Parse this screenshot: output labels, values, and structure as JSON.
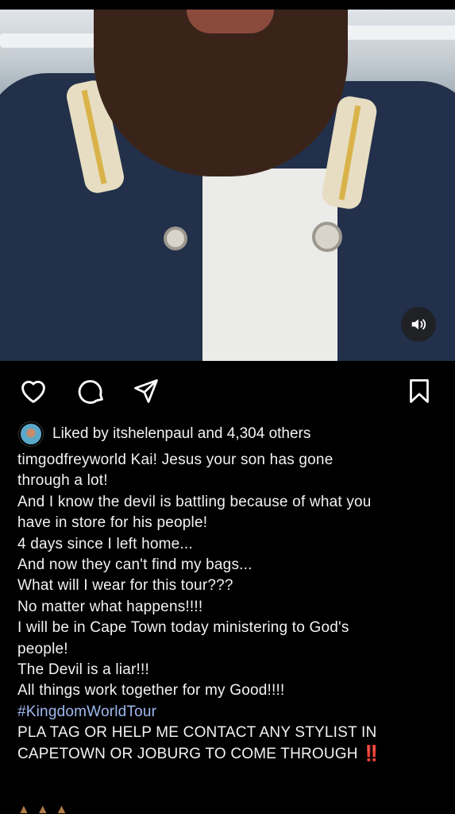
{
  "post": {
    "likes": {
      "prefix": "Liked by",
      "user": "itshelenpaul",
      "conjunction": "and",
      "count": "4,304 others"
    },
    "caption": {
      "username": "timgodfreyworld",
      "lines": [
        "Kai! Jesus your son has gone",
        "through a lot!",
        "And I know the devil is battling because of what you",
        "have in store for his people!",
        "4 days since I left home...",
        "And now they can't find my bags...",
        "What will I wear for this tour???",
        "No matter what happens!!!!",
        "I will be in Cape Town today ministering to God's",
        "people!",
        "The Devil is a liar!!!",
        "All things work together for my Good!!!!"
      ],
      "hashtag": "#KingdomWorldTour",
      "request_lines": [
        "PLA TAG OR HELP ME CONTACT ANY STYLIST IN",
        "CAPETOWN OR JOBURG TO COME THROUGH"
      ],
      "alert_glyph": "‼️"
    }
  },
  "icons": {
    "like": "heart-icon",
    "comment": "comment-icon",
    "share": "send-icon",
    "save": "bookmark-icon",
    "sound": "speaker-icon"
  },
  "colors": {
    "background": "#000000",
    "text": "#f2f2f2",
    "hashtag": "#9fb9f0",
    "alert": "#e0242c"
  }
}
